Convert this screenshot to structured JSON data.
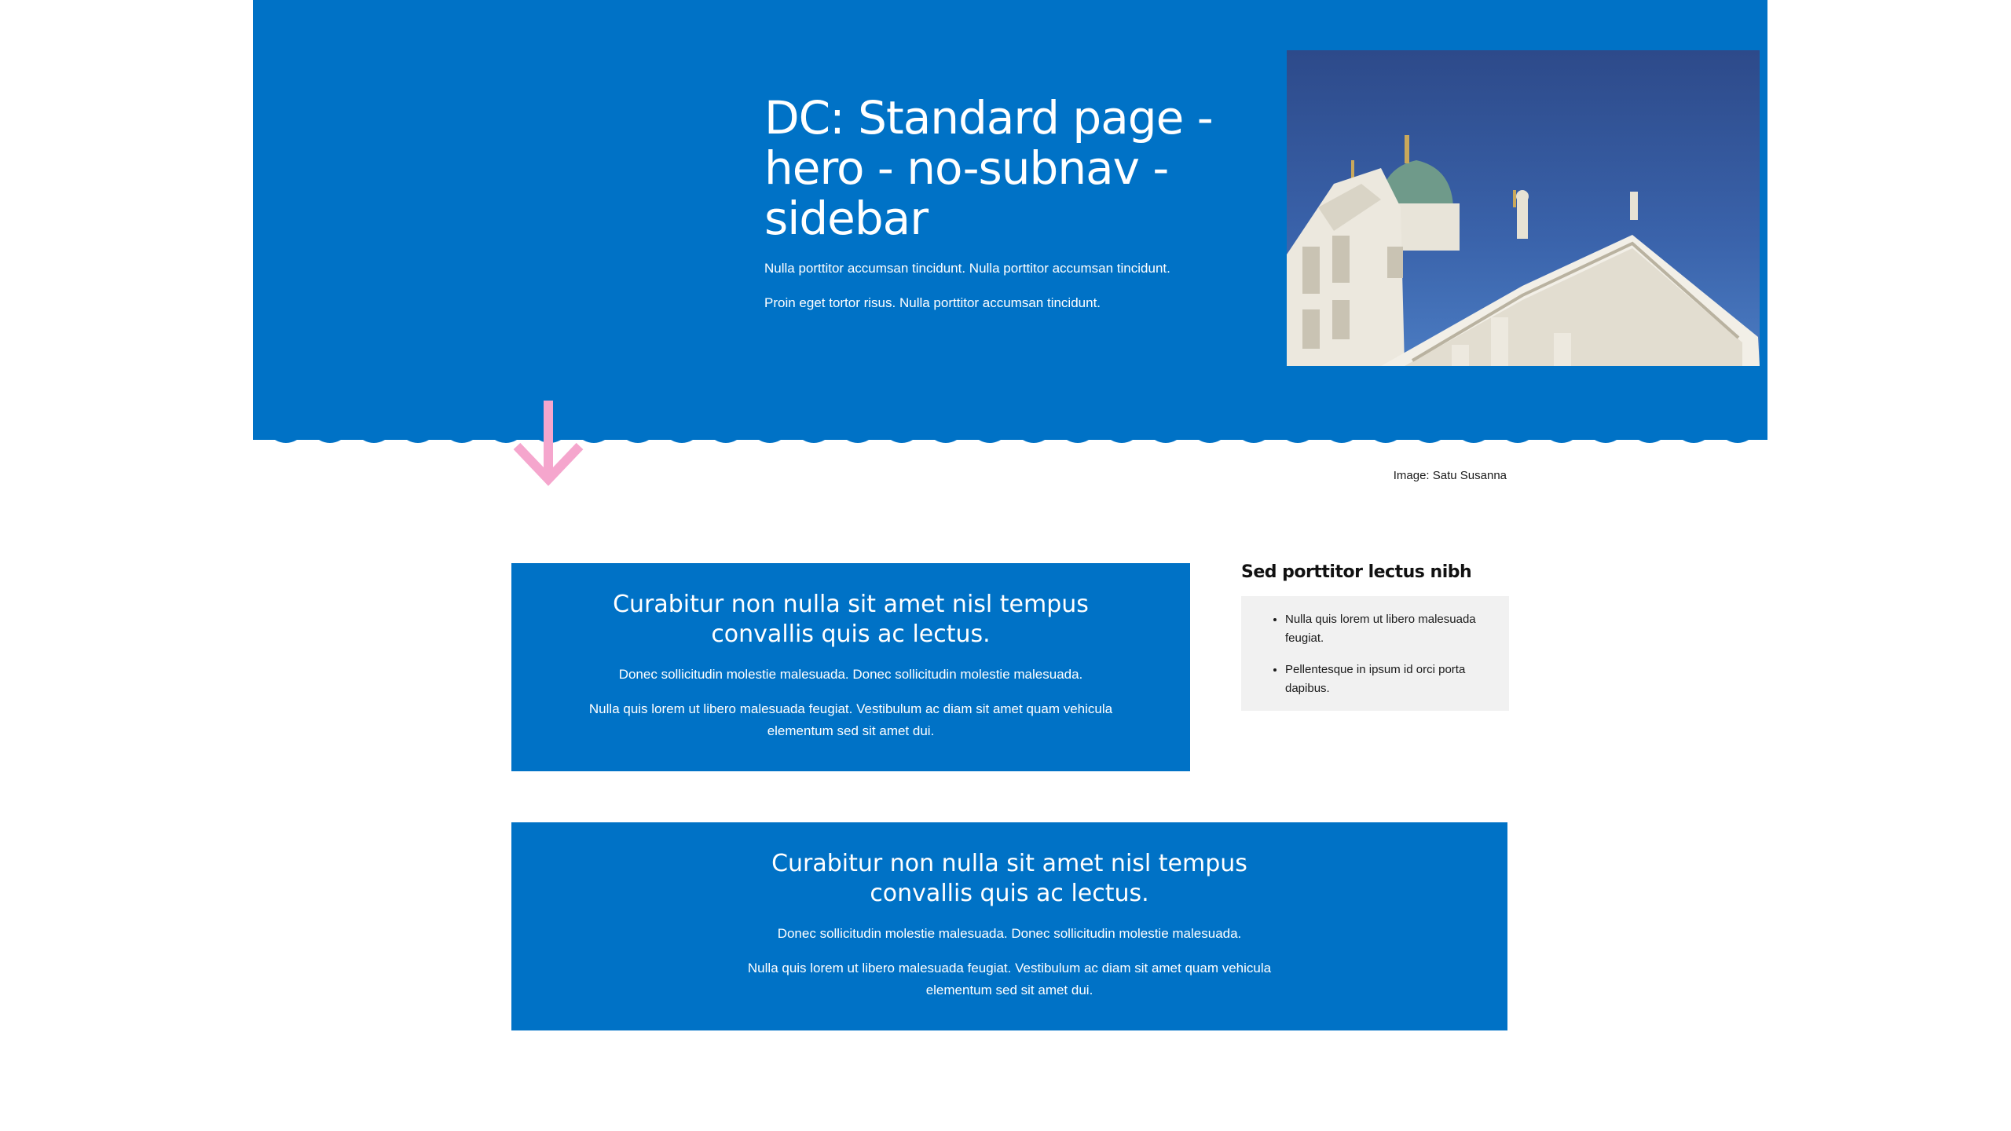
{
  "colors": {
    "hero_bg": "#0072c6",
    "card_bg": "#0072c6",
    "arrow": "#f5a6cd",
    "sidebar_box_bg": "#f1f1f1"
  },
  "hero": {
    "title": "DC: Standard page - hero - no-subnav - sidebar",
    "paragraph_1": "Nulla porttitor accumsan tincidunt. Nulla porttitor accumsan tincidunt.",
    "paragraph_2": "Proin eget tortor risus. Nulla porttitor accumsan tincidunt.",
    "image_icon": "cathedral-photo",
    "image_caption": "Image: Satu Susanna"
  },
  "scroll_indicator": {
    "icon": "arrow-down-icon"
  },
  "main": {
    "card_1": {
      "title": "Curabitur non nulla sit amet nisl tempus convallis quis ac lectus.",
      "paragraph_1": "Donec sollicitudin molestie malesuada. Donec sollicitudin molestie malesuada.",
      "paragraph_2": "Nulla quis lorem ut libero malesuada feugiat. Vestibulum ac diam sit amet quam vehicula elementum sed sit amet dui."
    },
    "card_2": {
      "title": "Curabitur non nulla sit amet nisl tempus convallis quis ac lectus.",
      "paragraph_1": "Donec sollicitudin molestie malesuada. Donec sollicitudin molestie malesuada.",
      "paragraph_2": "Nulla quis lorem ut libero malesuada feugiat. Vestibulum ac diam sit amet quam vehicula elementum sed sit amet dui."
    }
  },
  "sidebar": {
    "title": "Sed porttitor lectus nibh",
    "items": [
      {
        "label": "Nulla quis lorem ut libero malesuada feugiat."
      },
      {
        "label": "Pellentesque in ipsum id orci porta dapibus."
      }
    ]
  }
}
